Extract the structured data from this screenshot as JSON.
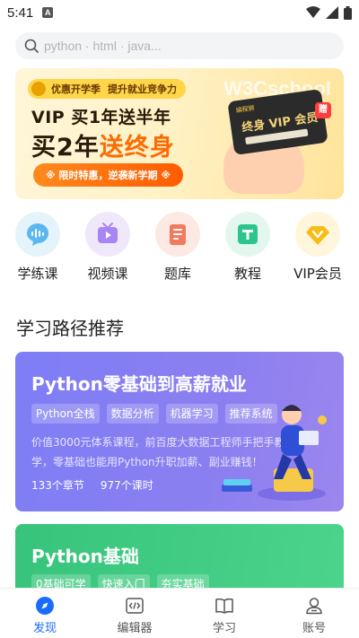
{
  "status_bar": {
    "time": "5:41",
    "notification_letter": "A"
  },
  "search": {
    "placeholder": "python · html · java..."
  },
  "banner": {
    "promo_chip_label": "优惠开学季",
    "promo_chip_slogan": "提升就业竞争力",
    "headline_1": "VIP 买1年送半年",
    "headline_2_prefix": "买2年",
    "headline_2_highlight": "送终身",
    "cta_label": "※ 限时特惠，逆袭新学期 ※",
    "watermark": "W3Cschool",
    "card_logo": "编程狮",
    "card_title": "终身 VIP 会员",
    "gift_label": "赠"
  },
  "quick_entries": [
    {
      "label": "学练课",
      "icon": "voice-wave-icon",
      "bg": "#e5f4fb",
      "color": "#5ab7f0"
    },
    {
      "label": "视频课",
      "icon": "tv-play-icon",
      "bg": "#efe8fb",
      "color": "#a785f2"
    },
    {
      "label": "题库",
      "icon": "question-bank-icon",
      "bg": "#fde9e4",
      "color": "#f07a5e"
    },
    {
      "label": "教程",
      "icon": "tutorial-icon",
      "bg": "#e3f7ef",
      "color": "#2cc58d"
    },
    {
      "label": "VIP会员",
      "icon": "vip-diamond-icon",
      "bg": "#fff6dc",
      "color": "#f6bd16"
    }
  ],
  "section": {
    "title": "学习路径推荐"
  },
  "path_cards": [
    {
      "title": "Python零基础到高薪就业",
      "tags": [
        "Python全栈",
        "数据分析",
        "机器学习",
        "推荐系统"
      ],
      "description": "价值3000元体系课程，前百度大数据工程师手把手教学，零基础也能用Python升职加薪、副业赚钱！",
      "chapters": "133个章节",
      "lessons": "977个课时",
      "color": "#8180f4"
    },
    {
      "title": "Python基础",
      "tags": [
        "0基础可学",
        "快速入门",
        "夯实基础"
      ],
      "color": "#3fca81"
    }
  ],
  "tabbar": {
    "items": [
      {
        "label": "发现",
        "icon": "compass-icon",
        "active": true
      },
      {
        "label": "编辑器",
        "icon": "code-editor-icon",
        "active": false
      },
      {
        "label": "学习",
        "icon": "book-icon",
        "active": false
      },
      {
        "label": "账号",
        "icon": "user-icon",
        "active": false
      }
    ],
    "active_color": "#1a6cff"
  }
}
